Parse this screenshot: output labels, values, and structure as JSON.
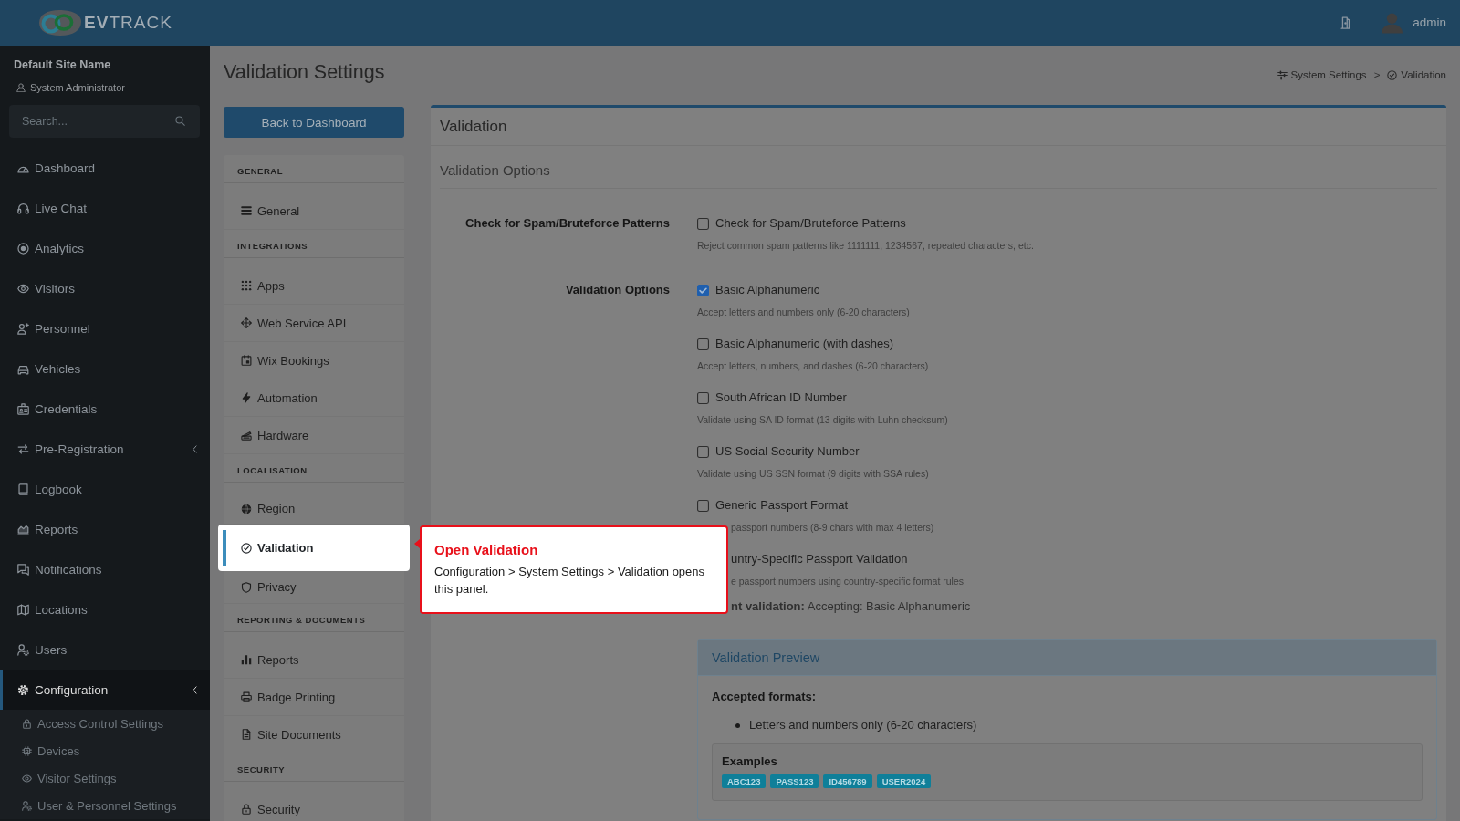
{
  "header": {
    "logo_text": "**EV**TRACK",
    "user": "admin"
  },
  "sidebar": {
    "site_name": "Default Site Name",
    "role": "System Administrator",
    "search": {
      "placeholder": "Search..."
    },
    "items": [
      {
        "label": "Dashboard",
        "selected": false,
        "has_submenu": false
      },
      {
        "label": "Live Chat",
        "selected": false,
        "has_submenu": false
      },
      {
        "label": "Analytics",
        "selected": false,
        "has_submenu": false
      },
      {
        "label": "Visitors",
        "selected": false,
        "has_submenu": false
      },
      {
        "label": "Personnel",
        "selected": false,
        "has_submenu": false
      },
      {
        "label": "Vehicles",
        "selected": false,
        "has_submenu": false
      },
      {
        "label": "Credentials",
        "selected": false,
        "has_submenu": false
      },
      {
        "label": "Pre-Registration",
        "selected": false,
        "has_submenu": true
      },
      {
        "label": "Logbook",
        "selected": false,
        "has_submenu": false
      },
      {
        "label": "Reports",
        "selected": false,
        "has_submenu": false
      },
      {
        "label": "Notifications",
        "selected": false,
        "has_submenu": false
      },
      {
        "label": "Locations",
        "selected": false,
        "has_submenu": false
      },
      {
        "label": "Users",
        "selected": false,
        "has_submenu": false
      },
      {
        "label": "Configuration",
        "selected": true,
        "has_submenu": true,
        "children": [
          {
            "label": "Access Control Settings",
            "selected": false
          },
          {
            "label": "Devices",
            "selected": false
          },
          {
            "label": "Visitor Settings",
            "selected": false
          },
          {
            "label": "User & Personnel Settings",
            "selected": false
          }
        ]
      }
    ]
  },
  "page": {
    "title": "Validation Settings",
    "breadcrumb": [
      {
        "label": "System Settings"
      },
      {
        "label": "Validation"
      }
    ],
    "breadcrumb_separator": ">",
    "back_button": "Back to Dashboard"
  },
  "settings_nav": [
    {
      "heading": "GENERAL",
      "items": [
        {
          "label": "General",
          "selected": false
        }
      ]
    },
    {
      "heading": "INTEGRATIONS",
      "items": [
        {
          "label": "Apps",
          "selected": false
        },
        {
          "label": "Web Service API",
          "selected": false
        },
        {
          "label": "Wix Bookings",
          "selected": false
        },
        {
          "label": "Automation",
          "selected": false
        },
        {
          "label": "Hardware",
          "selected": false
        }
      ]
    },
    {
      "heading": "LOCALISATION",
      "items": [
        {
          "label": "Region",
          "selected": false
        },
        {
          "label": "Validation",
          "selected": true
        },
        {
          "label": "Privacy",
          "selected": false
        }
      ]
    },
    {
      "heading": "REPORTING & DOCUMENTS",
      "items": [
        {
          "label": "Reports",
          "selected": false
        },
        {
          "label": "Badge Printing",
          "selected": false
        },
        {
          "label": "Site Documents",
          "selected": false
        }
      ]
    },
    {
      "heading": "SECURITY",
      "items": [
        {
          "label": "Security",
          "selected": false
        }
      ]
    }
  ],
  "validation_card": {
    "title": "Validation",
    "section_title": "Validation Options",
    "rows": [
      {
        "label": "Check for Spam/Bruteforce Patterns",
        "options": [
          {
            "kind": "clear",
            "label": "Check for Spam/Bruteforce Patterns",
            "checked": false,
            "description": "Reject common spam patterns like 1111111, 1234567, repeated characters, etc."
          }
        ]
      },
      {
        "label": "Validation Options",
        "options": [
          {
            "kind": "clear",
            "label": "Basic Alphanumeric",
            "checked": true,
            "description": "Accept letters and numbers only (6-20 characters)"
          },
          {
            "kind": "clear",
            "label": "Basic Alphanumeric (with dashes)",
            "checked": false,
            "description": "Accept letters, numbers, and dashes (6-20 characters)"
          },
          {
            "kind": "clear",
            "label": "South African ID Number",
            "checked": false,
            "description": "Validate using SA ID format (13 digits with Luhn checksum)"
          },
          {
            "kind": "clear",
            "label": "US Social Security Number",
            "checked": false,
            "description": "Validate using US SSN format (9 digits with SSA rules)"
          },
          {
            "kind": "partial",
            "label": "Generic Passport Format",
            "checked": false,
            "description": "passport numbers (8-9 chars with max 4 letters)"
          },
          {
            "kind": "covered",
            "label": "untry-Specific Passport Validation",
            "description": "e passport numbers using country-specific format rules"
          }
        ]
      }
    ],
    "current_validation": "**nt validation:** Accepting: Basic Alphanumeric"
  },
  "preview": {
    "title": "Validation Preview",
    "accepted_heading": "Accepted formats:",
    "formats": [
      "Letters and numbers only (6-20 characters)"
    ],
    "examples_heading": "Examples",
    "examples": [
      "ABC123",
      "PASS123",
      "ID456789",
      "USER2024"
    ]
  },
  "tour": {
    "title": "Open Validation",
    "text": "Configuration > System Settings > Validation opens this panel."
  }
}
